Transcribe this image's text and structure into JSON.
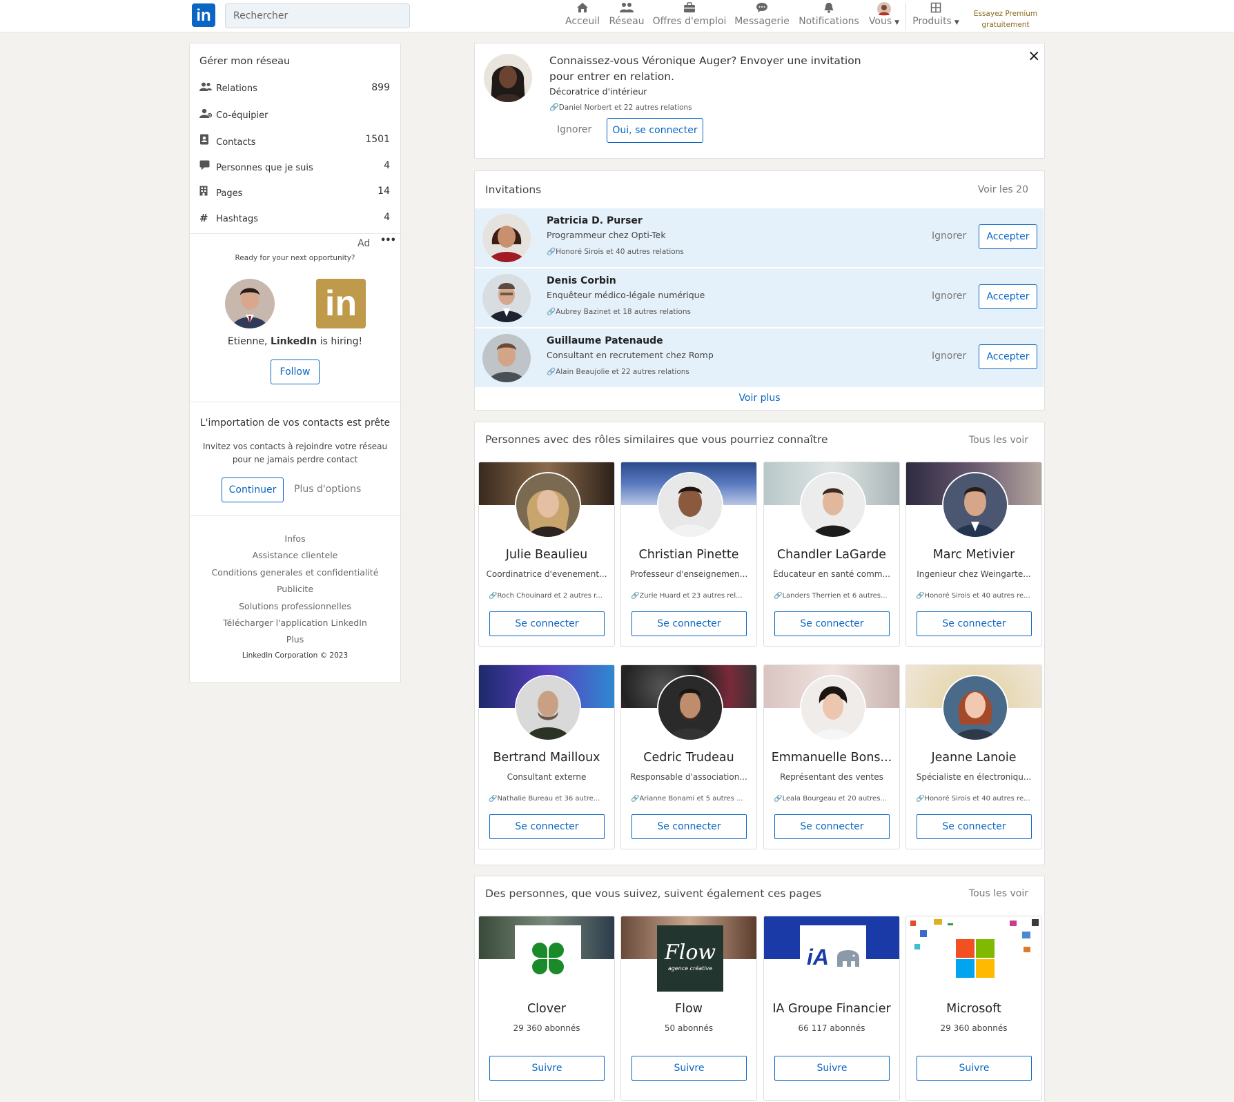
{
  "nav": {
    "search_placeholder": "Rechercher",
    "items": [
      {
        "label": "Acceuil",
        "icon": "home-icon"
      },
      {
        "label": "Réseau",
        "icon": "network-icon"
      },
      {
        "label": "Offres d'emploi",
        "icon": "briefcase-icon"
      },
      {
        "label": "Messagerie",
        "icon": "message-icon"
      },
      {
        "label": "Notifications",
        "icon": "bell-icon"
      },
      {
        "label": "Vous",
        "icon": "avatar"
      },
      {
        "label": "Produits",
        "icon": "grid-icon"
      }
    ],
    "premium_line1": "Essayez Premium",
    "premium_line2": "gratuitement"
  },
  "sidebar": {
    "title": "Gérer mon réseau",
    "items": [
      {
        "label": "Relations",
        "count": "899",
        "icon": "people-icon"
      },
      {
        "label": "Co-équipier",
        "count": "",
        "icon": "teammate-icon"
      },
      {
        "label": "Contacts",
        "count": "1501",
        "icon": "contact-book-icon"
      },
      {
        "label": "Personnes que je suis",
        "count": "4",
        "icon": "speech-icon"
      },
      {
        "label": "Pages",
        "count": "14",
        "icon": "building-icon"
      },
      {
        "label": "Hashtags",
        "count": "4",
        "icon": "hashtag-icon"
      }
    ],
    "ad": {
      "label": "Ad",
      "menu": "•••",
      "tagline": "Ready for your next opportunity?",
      "hiring_prefix": "Etienne, ",
      "hiring_brand": "LinkedIn",
      "hiring_suffix": " is hiring!",
      "follow": "Follow",
      "logo_text": "in"
    },
    "import": {
      "title": "L'importation de vos contacts est prête",
      "desc_line1": "Invitez vos contacts à rejoindre votre réseau",
      "desc_line2": "pour ne jamais perdre contact",
      "continue": "Continuer",
      "more": "Plus d'options"
    },
    "footer": {
      "links": [
        "Infos",
        "Assistance clientele",
        "Conditions generales et confidentialité",
        "Publicite",
        "Solutions professionnelles",
        "Télécharger l'application LinkedIn",
        "Plus"
      ],
      "copyright": "LinkedIn Corporation © 2023"
    }
  },
  "suggestion": {
    "line1": "Connaissez-vous Véronique Auger? Envoyer une invitation",
    "line2": "pour entrer en relation.",
    "title": "Décoratrice d'intérieur",
    "mutual": "Daniel Norbert et 22 autres relations",
    "ignore": "Ignorer",
    "connect": "Oui, se connecter",
    "close": "×"
  },
  "invitations": {
    "title": "Invitations",
    "see_all": "Voir les 20",
    "ignore": "Ignorer",
    "accept": "Accepter",
    "more": "Voir plus",
    "items": [
      {
        "name": "Patricia D. Purser",
        "title": "Programmeur chez Opti-Tek",
        "mutual": "Honoré Sirois et 40 autres relations"
      },
      {
        "name": "Denis Corbin",
        "title": "Enquêteur médico-légale numérique",
        "mutual": "Aubrey Bazinet et 18 autres relations"
      },
      {
        "name": "Guillaume Patenaude",
        "title": "Consultant en recrutement chez Romp",
        "mutual": "Alain Beaujolie et 22 autres relations"
      }
    ]
  },
  "similar": {
    "title": "Personnes avec des rôles similaires que vous pourriez connaître",
    "see_all": "Tous les voir",
    "connect": "Se connecter",
    "people": [
      {
        "name": "Julie Beaulieu",
        "title": "Coordinatrice d'evenement...",
        "mutual": "Roch Chouinard et 2 autres r..."
      },
      {
        "name": "Christian Pinette",
        "title": "Professeur d'enseignemen...",
        "mutual": "Zurie Huard et 23 autres rel..."
      },
      {
        "name": "Chandler LaGarde",
        "title": "Éducateur en santé comm...",
        "mutual": "Landers Therrien et 6 autres..."
      },
      {
        "name": "Marc Metivier",
        "title": "Ingenieur chez Weingarte...",
        "mutual": "Honoré Sirois et 40 autres re..."
      },
      {
        "name": "Bertrand Mailloux",
        "title": "Consultant externe",
        "mutual": "Nathalie Bureau et 36 autre..."
      },
      {
        "name": "Cedric Trudeau",
        "title": "Responsable d'association...",
        "mutual": "Arianne Bonami et 5 autres ..."
      },
      {
        "name": "Emmanuelle Bons...",
        "title": "Représentant des ventes",
        "mutual": "Leala Bourgeau et 20 autres..."
      },
      {
        "name": "Jeanne Lanoie",
        "title": "Spécialiste en électroniqu...",
        "mutual": "Honoré Sirois et 40 autres re..."
      }
    ]
  },
  "pages": {
    "title": "Des personnes, que vous suivez, suivent également ces pages",
    "see_all": "Tous les voir",
    "follow": "Suivre",
    "items": [
      {
        "name": "Clover",
        "followers": "29 360 abonnés"
      },
      {
        "name": "Flow",
        "followers": "50 abonnés",
        "logo_text": "Flow",
        "logo_sub": "agence créative"
      },
      {
        "name": "IA Groupe Financier",
        "followers": "66 117 abonnés",
        "logo_text": "iA"
      },
      {
        "name": "Microsoft",
        "followers": "29 360 abonnés"
      }
    ]
  },
  "colors": {
    "accent": "#0a66c2",
    "invite_bg": "#e5f1fa",
    "premium": "#8a6d1f",
    "ad_logo": "#c09a4b"
  }
}
